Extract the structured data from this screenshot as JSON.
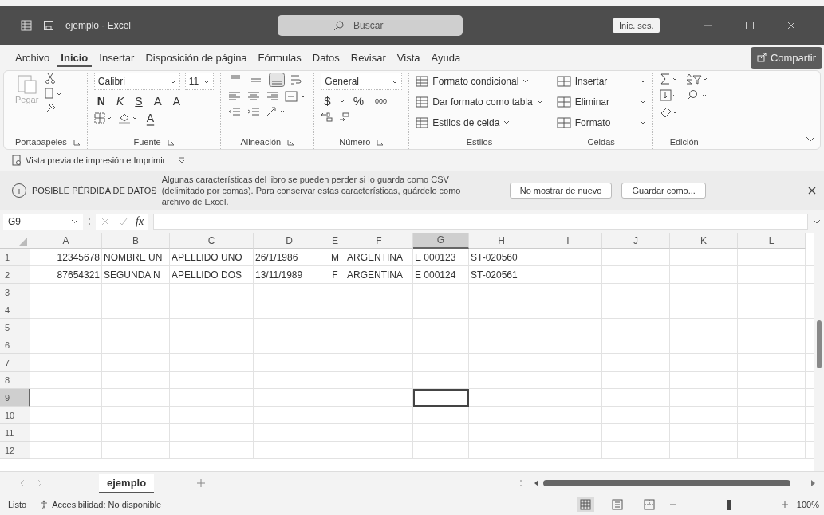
{
  "title_bar": {
    "title": "ejemplo - Excel",
    "search_placeholder": "Buscar",
    "sign_in": "Inic. ses."
  },
  "menu_tabs": [
    {
      "label": "Archivo",
      "selected": false
    },
    {
      "label": "Inicio",
      "selected": true
    },
    {
      "label": "Insertar",
      "selected": false
    },
    {
      "label": "Disposición de página",
      "selected": false
    },
    {
      "label": "Fórmulas",
      "selected": false
    },
    {
      "label": "Datos",
      "selected": false
    },
    {
      "label": "Revisar",
      "selected": false
    },
    {
      "label": "Vista",
      "selected": false
    },
    {
      "label": "Ayuda",
      "selected": false
    }
  ],
  "share_button": "Compartir",
  "ribbon": {
    "clipboard": {
      "label": "Portapapeles",
      "paste": "Pegar"
    },
    "font": {
      "label": "Fuente",
      "font_name": "Calibri",
      "font_size": "11",
      "bold": "N",
      "italic": "K",
      "underline": "S",
      "grow": "A",
      "shrink": "A",
      "tint": "A"
    },
    "alignment": {
      "label": "Alineación",
      "vertical_align": [
        {
          "selected": false
        },
        {
          "selected": false
        },
        {
          "selected": true
        }
      ]
    },
    "number": {
      "label": "Número",
      "format": "General",
      "currency": "$",
      "percent": "%",
      "thousands": "000"
    },
    "styles": {
      "label": "Estilos",
      "items": [
        "Formato condicional",
        "Dar formato como tabla",
        "Estilos de celda"
      ]
    },
    "cells": {
      "label": "Celdas",
      "items": [
        "Insertar",
        "Eliminar",
        "Formato"
      ]
    },
    "editing": {
      "label": "Edición"
    }
  },
  "quick_access": {
    "label": "Vista previa de impresión e Imprimir"
  },
  "info_bar": {
    "title": "POSIBLE PÉRDIDA DE DATOS",
    "message": "Algunas características del libro se pueden perder si lo guarda como CSV (delimitado por comas). Para conservar estas características, guárdelo como archivo de Excel.",
    "buttons": [
      "No mostrar de nuevo",
      "Guardar como..."
    ]
  },
  "formula_bar": {
    "name_box": "G9",
    "fx": "fx"
  },
  "columns": [
    {
      "label": "A",
      "kind": "numeric",
      "selected": false
    },
    {
      "label": "B",
      "kind": "text",
      "selected": false
    },
    {
      "label": "C",
      "kind": "text",
      "selected": false
    },
    {
      "label": "D",
      "kind": "text",
      "selected": false
    },
    {
      "label": "E",
      "kind": "centered",
      "selected": false
    },
    {
      "label": "F",
      "kind": "text",
      "selected": false
    },
    {
      "label": "G",
      "kind": "text",
      "selected": true
    },
    {
      "label": "H",
      "kind": "text",
      "selected": false
    },
    {
      "label": "I",
      "kind": "text",
      "selected": false
    },
    {
      "label": "J",
      "kind": "text",
      "selected": false
    },
    {
      "label": "K",
      "kind": "text",
      "selected": false
    },
    {
      "label": "L",
      "kind": "text",
      "selected": false
    }
  ],
  "rows": [
    {
      "number": "1",
      "selected": false,
      "cells": [
        "12345678",
        "NOMBRE UN",
        "APELLIDO UNO",
        "26/1/1986",
        "M",
        "ARGENTINA",
        "E 000123",
        "ST-020560"
      ]
    },
    {
      "number": "2",
      "selected": false,
      "cells": [
        "87654321",
        "SEGUNDA N",
        "APELLIDO DOS",
        "13/11/1989",
        "F",
        "ARGENTINA",
        "E 000124",
        "ST-020561"
      ]
    },
    {
      "number": "3",
      "selected": false
    },
    {
      "number": "4",
      "selected": false
    },
    {
      "number": "5",
      "selected": false
    },
    {
      "number": "6",
      "selected": false
    },
    {
      "number": "7",
      "selected": false
    },
    {
      "number": "8",
      "selected": false
    },
    {
      "number": "9",
      "selected": true
    },
    {
      "number": "10",
      "selected": false
    },
    {
      "number": "11",
      "selected": false
    },
    {
      "number": "12",
      "selected": false
    }
  ],
  "sheet_tabs": [
    {
      "label": "ejemplo",
      "selected": true
    }
  ],
  "status_bar": {
    "status": "Listo",
    "accessibility": "Accesibilidad: No disponible",
    "views": [
      {
        "selected": true
      },
      {
        "selected": false
      },
      {
        "selected": false
      }
    ],
    "zoom": {
      "level": 0.5
    },
    "zoom_label": "100%"
  }
}
